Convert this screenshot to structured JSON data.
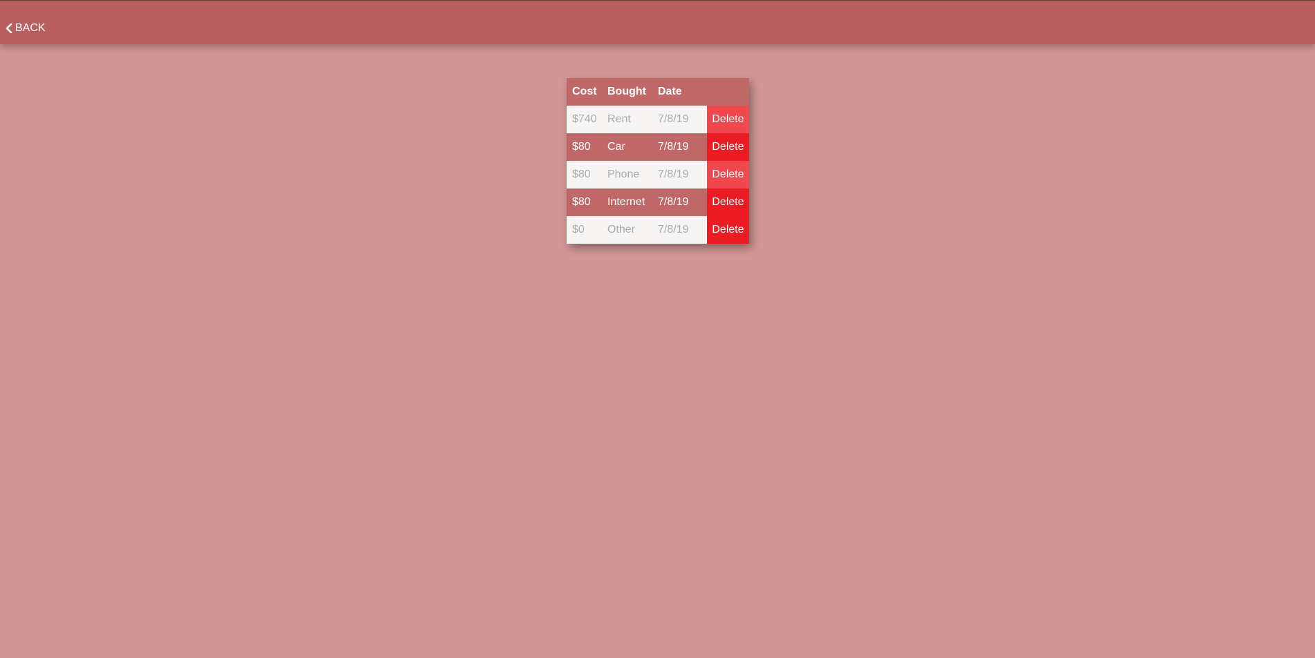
{
  "header": {
    "back_label": "BACK",
    "back_icon": "chevron-left-icon"
  },
  "table": {
    "columns": [
      "Cost",
      "Bought",
      "Date",
      ""
    ],
    "rows": [
      {
        "cost": "$740",
        "bought": "Rent",
        "date": "7/8/19",
        "action": "Delete",
        "style": "light"
      },
      {
        "cost": "$80",
        "bought": "Car",
        "date": "7/8/19",
        "action": "Delete",
        "style": "dark"
      },
      {
        "cost": "$80",
        "bought": "Phone",
        "date": "7/8/19",
        "action": "Delete",
        "style": "light"
      },
      {
        "cost": "$80",
        "bought": "Internet",
        "date": "7/8/19",
        "action": "Delete",
        "style": "dark"
      },
      {
        "cost": "$0",
        "bought": "Other",
        "date": "7/8/19",
        "action": "Delete",
        "style": "light"
      }
    ]
  },
  "colors": {
    "background": "#d39696",
    "topbar": "#b95f5f",
    "header_row": "#c06868",
    "light_row": "#f7f4f4",
    "delete_light": "#f1474d",
    "delete_strong": "#ec1c24"
  }
}
